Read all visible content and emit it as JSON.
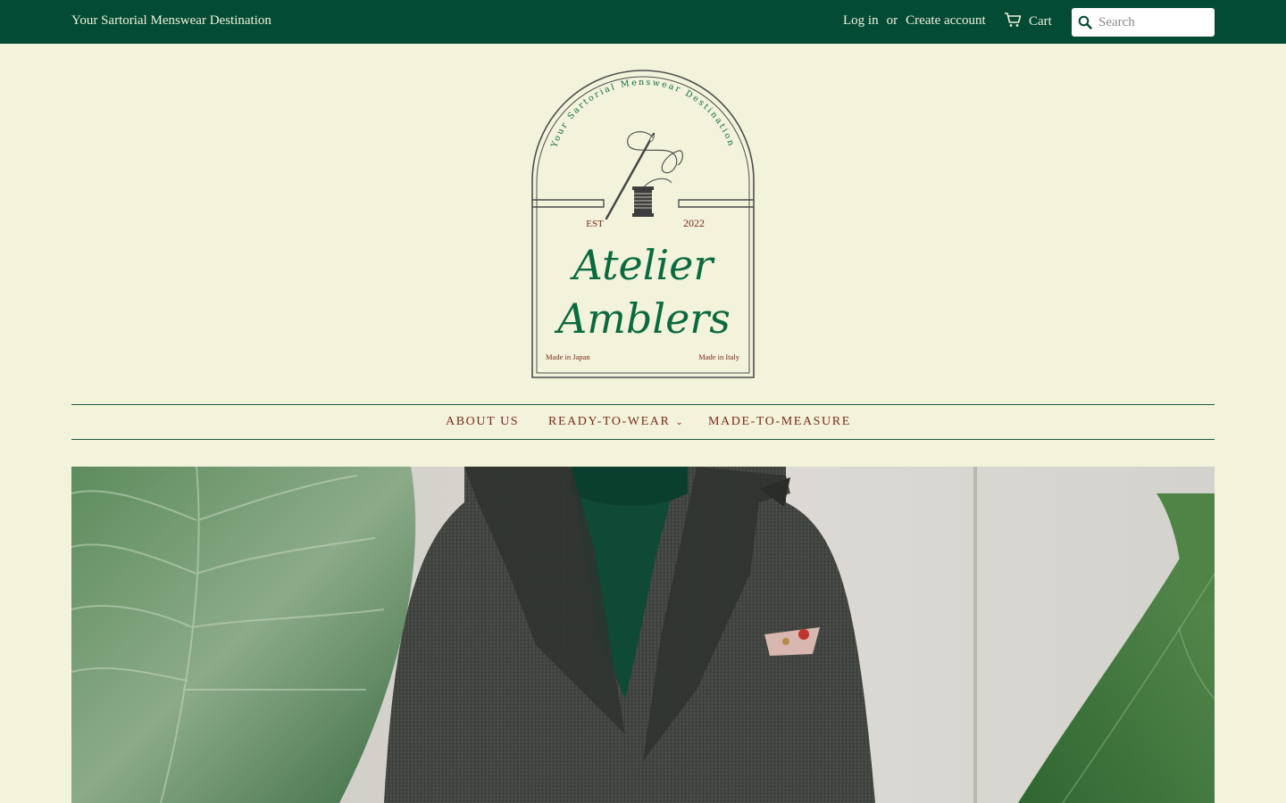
{
  "header": {
    "tagline": "Your Sartorial Menswear Destination",
    "login_label": "Log in",
    "or_label": "or",
    "create_account_label": "Create account",
    "cart_label": "Cart",
    "search_placeholder": "Search"
  },
  "logo": {
    "arc_text": "Your Sartorial Menswear Destination",
    "est_label": "EST",
    "year": "2022",
    "name_line1": "Atelier",
    "name_line2": "Amblers",
    "left_note": "Made in Japan",
    "right_note": "Made in Italy"
  },
  "nav": {
    "items": [
      {
        "label": "ABOUT US",
        "has_dropdown": false
      },
      {
        "label": "READY-TO-WEAR",
        "has_dropdown": true
      },
      {
        "label": "MADE-TO-MEASURE",
        "has_dropdown": false
      }
    ]
  },
  "colors": {
    "topbar": "#034b35",
    "background": "#f3f3dc",
    "nav_text": "#7a2a1c",
    "logo_green": "#0b6a3e"
  },
  "icons": {
    "cart": "cart-icon",
    "search": "search-icon",
    "dropdown": "chevron-down-icon"
  }
}
